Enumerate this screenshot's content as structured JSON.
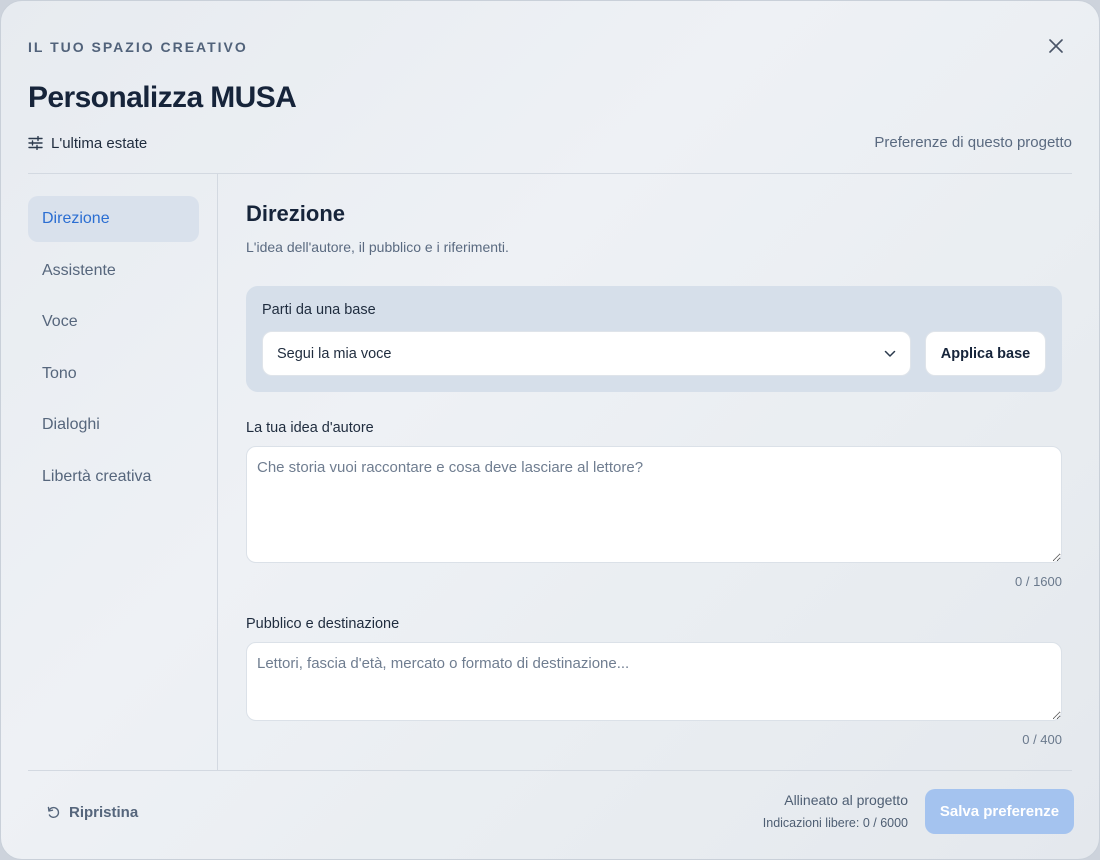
{
  "header": {
    "eyebrow": "IL TUO SPAZIO CREATIVO",
    "title": "Personalizza MUSA",
    "project_name": "L'ultima estate",
    "scope_label": "Preferenze di questo progetto"
  },
  "sidebar": {
    "items": [
      {
        "label": "Direzione",
        "active": true
      },
      {
        "label": "Assistente",
        "active": false
      },
      {
        "label": "Voce",
        "active": false
      },
      {
        "label": "Tono",
        "active": false
      },
      {
        "label": "Dialoghi",
        "active": false
      },
      {
        "label": "Libertà creativa",
        "active": false
      }
    ]
  },
  "main": {
    "section_title": "Direzione",
    "section_subtitle": "L'idea dell'autore, il pubblico e i riferimenti.",
    "base": {
      "label": "Parti da una base",
      "selected": "Segui la mia voce",
      "apply_label": "Applica base"
    },
    "author_idea": {
      "label": "La tua idea d'autore",
      "value": "",
      "placeholder": "Che storia vuoi raccontare e cosa deve lasciare al lettore?",
      "counter": "0 / 1600"
    },
    "audience": {
      "label": "Pubblico e destinazione",
      "value": "",
      "placeholder": "Lettori, fascia d'età, mercato o formato di destinazione...",
      "counter": "0 / 400"
    }
  },
  "footer": {
    "reset_label": "Ripristina",
    "status_main": "Allineato al progetto",
    "status_sub": "Indicazioni libere: 0 / 6000",
    "save_label": "Salva preferenze"
  },
  "colors": {
    "accent": "#2b6ed2",
    "save_button": "#a4c3ef",
    "active_nav_bg": "#d9e1ec",
    "base_card_bg": "#d6dfea"
  },
  "icons": {
    "close": "close-icon",
    "project": "sliders-icon",
    "select": "chevron-down-icon",
    "reset": "refresh-icon"
  }
}
